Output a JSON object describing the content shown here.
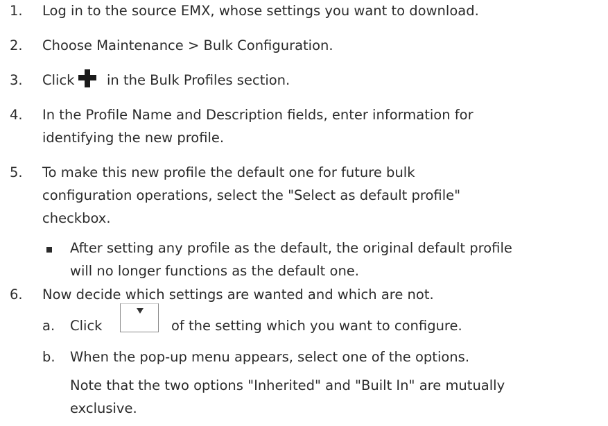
{
  "steps": [
    {
      "num": "1.",
      "lines": [
        "Log in to the source EMX, whose settings you want to download."
      ]
    },
    {
      "num": "2.",
      "lines": [
        "Choose Maintenance > Bulk Configuration."
      ]
    },
    {
      "num": "3.",
      "pre": "Click",
      "post": "in the Bulk Profiles section.",
      "icon": "plus-icon"
    },
    {
      "num": "4.",
      "lines": [
        "In the Profile Name and Description fields, enter information for",
        "identifying the new profile."
      ]
    },
    {
      "num": "5.",
      "lines": [
        "To make this new profile the default one for future bulk",
        "configuration operations, select the \"Select as default profile\"",
        "checkbox."
      ]
    },
    {
      "num": "6.",
      "lines": [
        "Now decide which settings are wanted and which are not."
      ]
    }
  ],
  "bullet": {
    "lines": [
      "After setting any profile as the default, the original default profile",
      " will no longer functions as the default one."
    ]
  },
  "substeps": [
    {
      "num": "a.",
      "pre": "Click",
      "post": "of the setting which you want to configure.",
      "icon": "dropdown-icon"
    },
    {
      "num": "b.",
      "lines": [
        "When the pop-up menu appears, select one of the options."
      ]
    }
  ],
  "note": {
    "lines": [
      "Note that the two options \"Inherited\" and \"Built In\" are mutually",
      "exclusive."
    ]
  }
}
